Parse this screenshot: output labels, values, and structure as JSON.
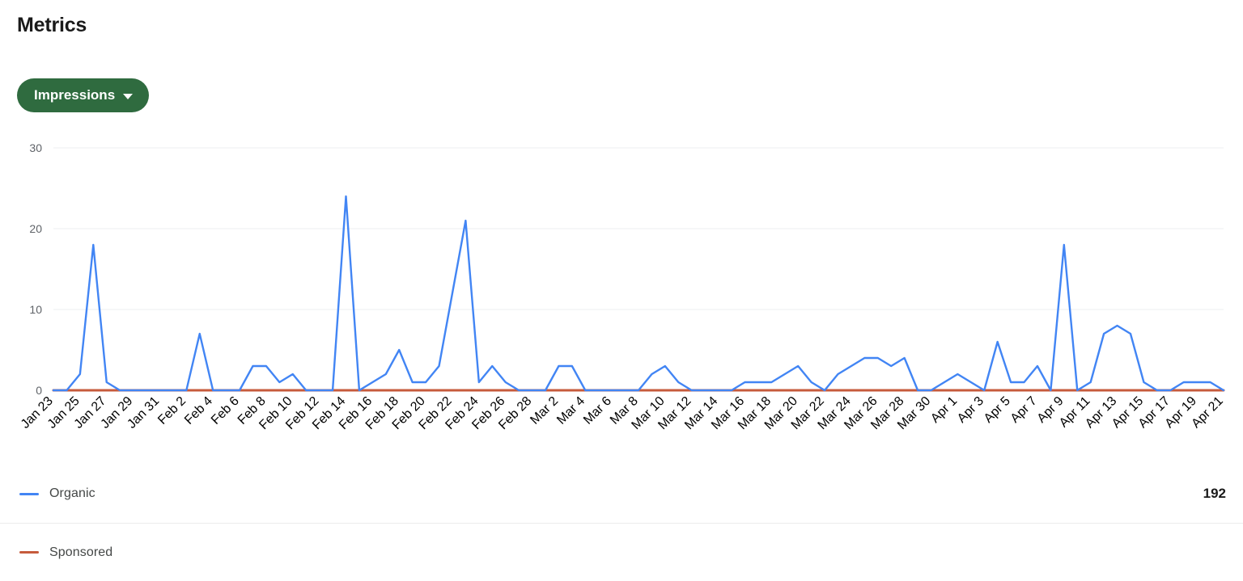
{
  "header": {
    "title": "Metrics"
  },
  "metric_selector": {
    "label": "Impressions",
    "icon": "chevron-down-icon",
    "background_color": "#2f6b3f",
    "text_color": "#ffffff"
  },
  "legend": [
    {
      "label": "Organic",
      "value": "192",
      "color": "#4285f4"
    },
    {
      "label": "Sponsored",
      "value": "",
      "color": "#c65b3c"
    }
  ],
  "chart_data": {
    "type": "line",
    "title": "Metrics",
    "xlabel": "",
    "ylabel": "",
    "ylim": [
      0,
      30
    ],
    "yticks": [
      0,
      10,
      20,
      30
    ],
    "grid": true,
    "legend_position": "bottom",
    "x": [
      "Jan 23",
      "Jan 24",
      "Jan 25",
      "Jan 26",
      "Jan 27",
      "Jan 28",
      "Jan 29",
      "Jan 30",
      "Jan 31",
      "Feb 1",
      "Feb 2",
      "Feb 3",
      "Feb 4",
      "Feb 5",
      "Feb 6",
      "Feb 7",
      "Feb 8",
      "Feb 9",
      "Feb 10",
      "Feb 11",
      "Feb 12",
      "Feb 13",
      "Feb 14",
      "Feb 15",
      "Feb 16",
      "Feb 17",
      "Feb 18",
      "Feb 19",
      "Feb 20",
      "Feb 21",
      "Feb 22",
      "Feb 23",
      "Feb 24",
      "Feb 25",
      "Feb 26",
      "Feb 27",
      "Feb 28",
      "Mar 1",
      "Mar 2",
      "Mar 3",
      "Mar 4",
      "Mar 5",
      "Mar 6",
      "Mar 7",
      "Mar 8",
      "Mar 9",
      "Mar 10",
      "Mar 11",
      "Mar 12",
      "Mar 13",
      "Mar 14",
      "Mar 15",
      "Mar 16",
      "Mar 17",
      "Mar 18",
      "Mar 19",
      "Mar 20",
      "Mar 21",
      "Mar 22",
      "Mar 23",
      "Mar 24",
      "Mar 25",
      "Mar 26",
      "Mar 27",
      "Mar 28",
      "Mar 29",
      "Mar 30",
      "Mar 31",
      "Apr 1",
      "Apr 2",
      "Apr 3",
      "Apr 4",
      "Apr 5",
      "Apr 6",
      "Apr 7",
      "Apr 8",
      "Apr 9",
      "Apr 10",
      "Apr 11",
      "Apr 12",
      "Apr 13",
      "Apr 14",
      "Apr 15",
      "Apr 16",
      "Apr 17",
      "Apr 18",
      "Apr 19",
      "Apr 20",
      "Apr 21"
    ],
    "xtick_labels": [
      "Jan 23",
      "Jan 25",
      "Jan 27",
      "Jan 29",
      "Jan 31",
      "Feb 2",
      "Feb 4",
      "Feb 6",
      "Feb 8",
      "Feb 10",
      "Feb 12",
      "Feb 14",
      "Feb 16",
      "Feb 18",
      "Feb 20",
      "Feb 22",
      "Feb 24",
      "Feb 26",
      "Feb 28",
      "Mar 2",
      "Mar 4",
      "Mar 6",
      "Mar 8",
      "Mar 10",
      "Mar 12",
      "Mar 14",
      "Mar 16",
      "Mar 18",
      "Mar 20",
      "Mar 22",
      "Mar 24",
      "Mar 26",
      "Mar 28",
      "Mar 30",
      "Apr 1",
      "Apr 3",
      "Apr 5",
      "Apr 7",
      "Apr 9",
      "Apr 11",
      "Apr 13",
      "Apr 15",
      "Apr 17",
      "Apr 19",
      "Apr 21"
    ],
    "series": [
      {
        "name": "Organic",
        "color": "#4285f4",
        "total": 192,
        "values": [
          0,
          0,
          2,
          18,
          1,
          0,
          0,
          0,
          0,
          0,
          0,
          7,
          0,
          0,
          0,
          3,
          3,
          1,
          2,
          0,
          0,
          0,
          24,
          0,
          1,
          2,
          5,
          1,
          1,
          3,
          12,
          21,
          1,
          3,
          1,
          0,
          0,
          0,
          3,
          3,
          0,
          0,
          0,
          0,
          0,
          2,
          3,
          1,
          0,
          0,
          0,
          0,
          1,
          1,
          1,
          2,
          3,
          1,
          0,
          2,
          3,
          4,
          4,
          3,
          4,
          0,
          0,
          1,
          2,
          1,
          0,
          6,
          1,
          1,
          3,
          0,
          18,
          0,
          1,
          7,
          8,
          7,
          1,
          0,
          0,
          1,
          1,
          1,
          0
        ]
      },
      {
        "name": "Sponsored",
        "color": "#c65b3c",
        "total": 0,
        "values": [
          0,
          0,
          0,
          0,
          0,
          0,
          0,
          0,
          0,
          0,
          0,
          0,
          0,
          0,
          0,
          0,
          0,
          0,
          0,
          0,
          0,
          0,
          0,
          0,
          0,
          0,
          0,
          0,
          0,
          0,
          0,
          0,
          0,
          0,
          0,
          0,
          0,
          0,
          0,
          0,
          0,
          0,
          0,
          0,
          0,
          0,
          0,
          0,
          0,
          0,
          0,
          0,
          0,
          0,
          0,
          0,
          0,
          0,
          0,
          0,
          0,
          0,
          0,
          0,
          0,
          0,
          0,
          0,
          0,
          0,
          0,
          0,
          0,
          0,
          0,
          0,
          0,
          0,
          0,
          0,
          0,
          0,
          0,
          0,
          0,
          0,
          0,
          0,
          0
        ]
      }
    ]
  }
}
